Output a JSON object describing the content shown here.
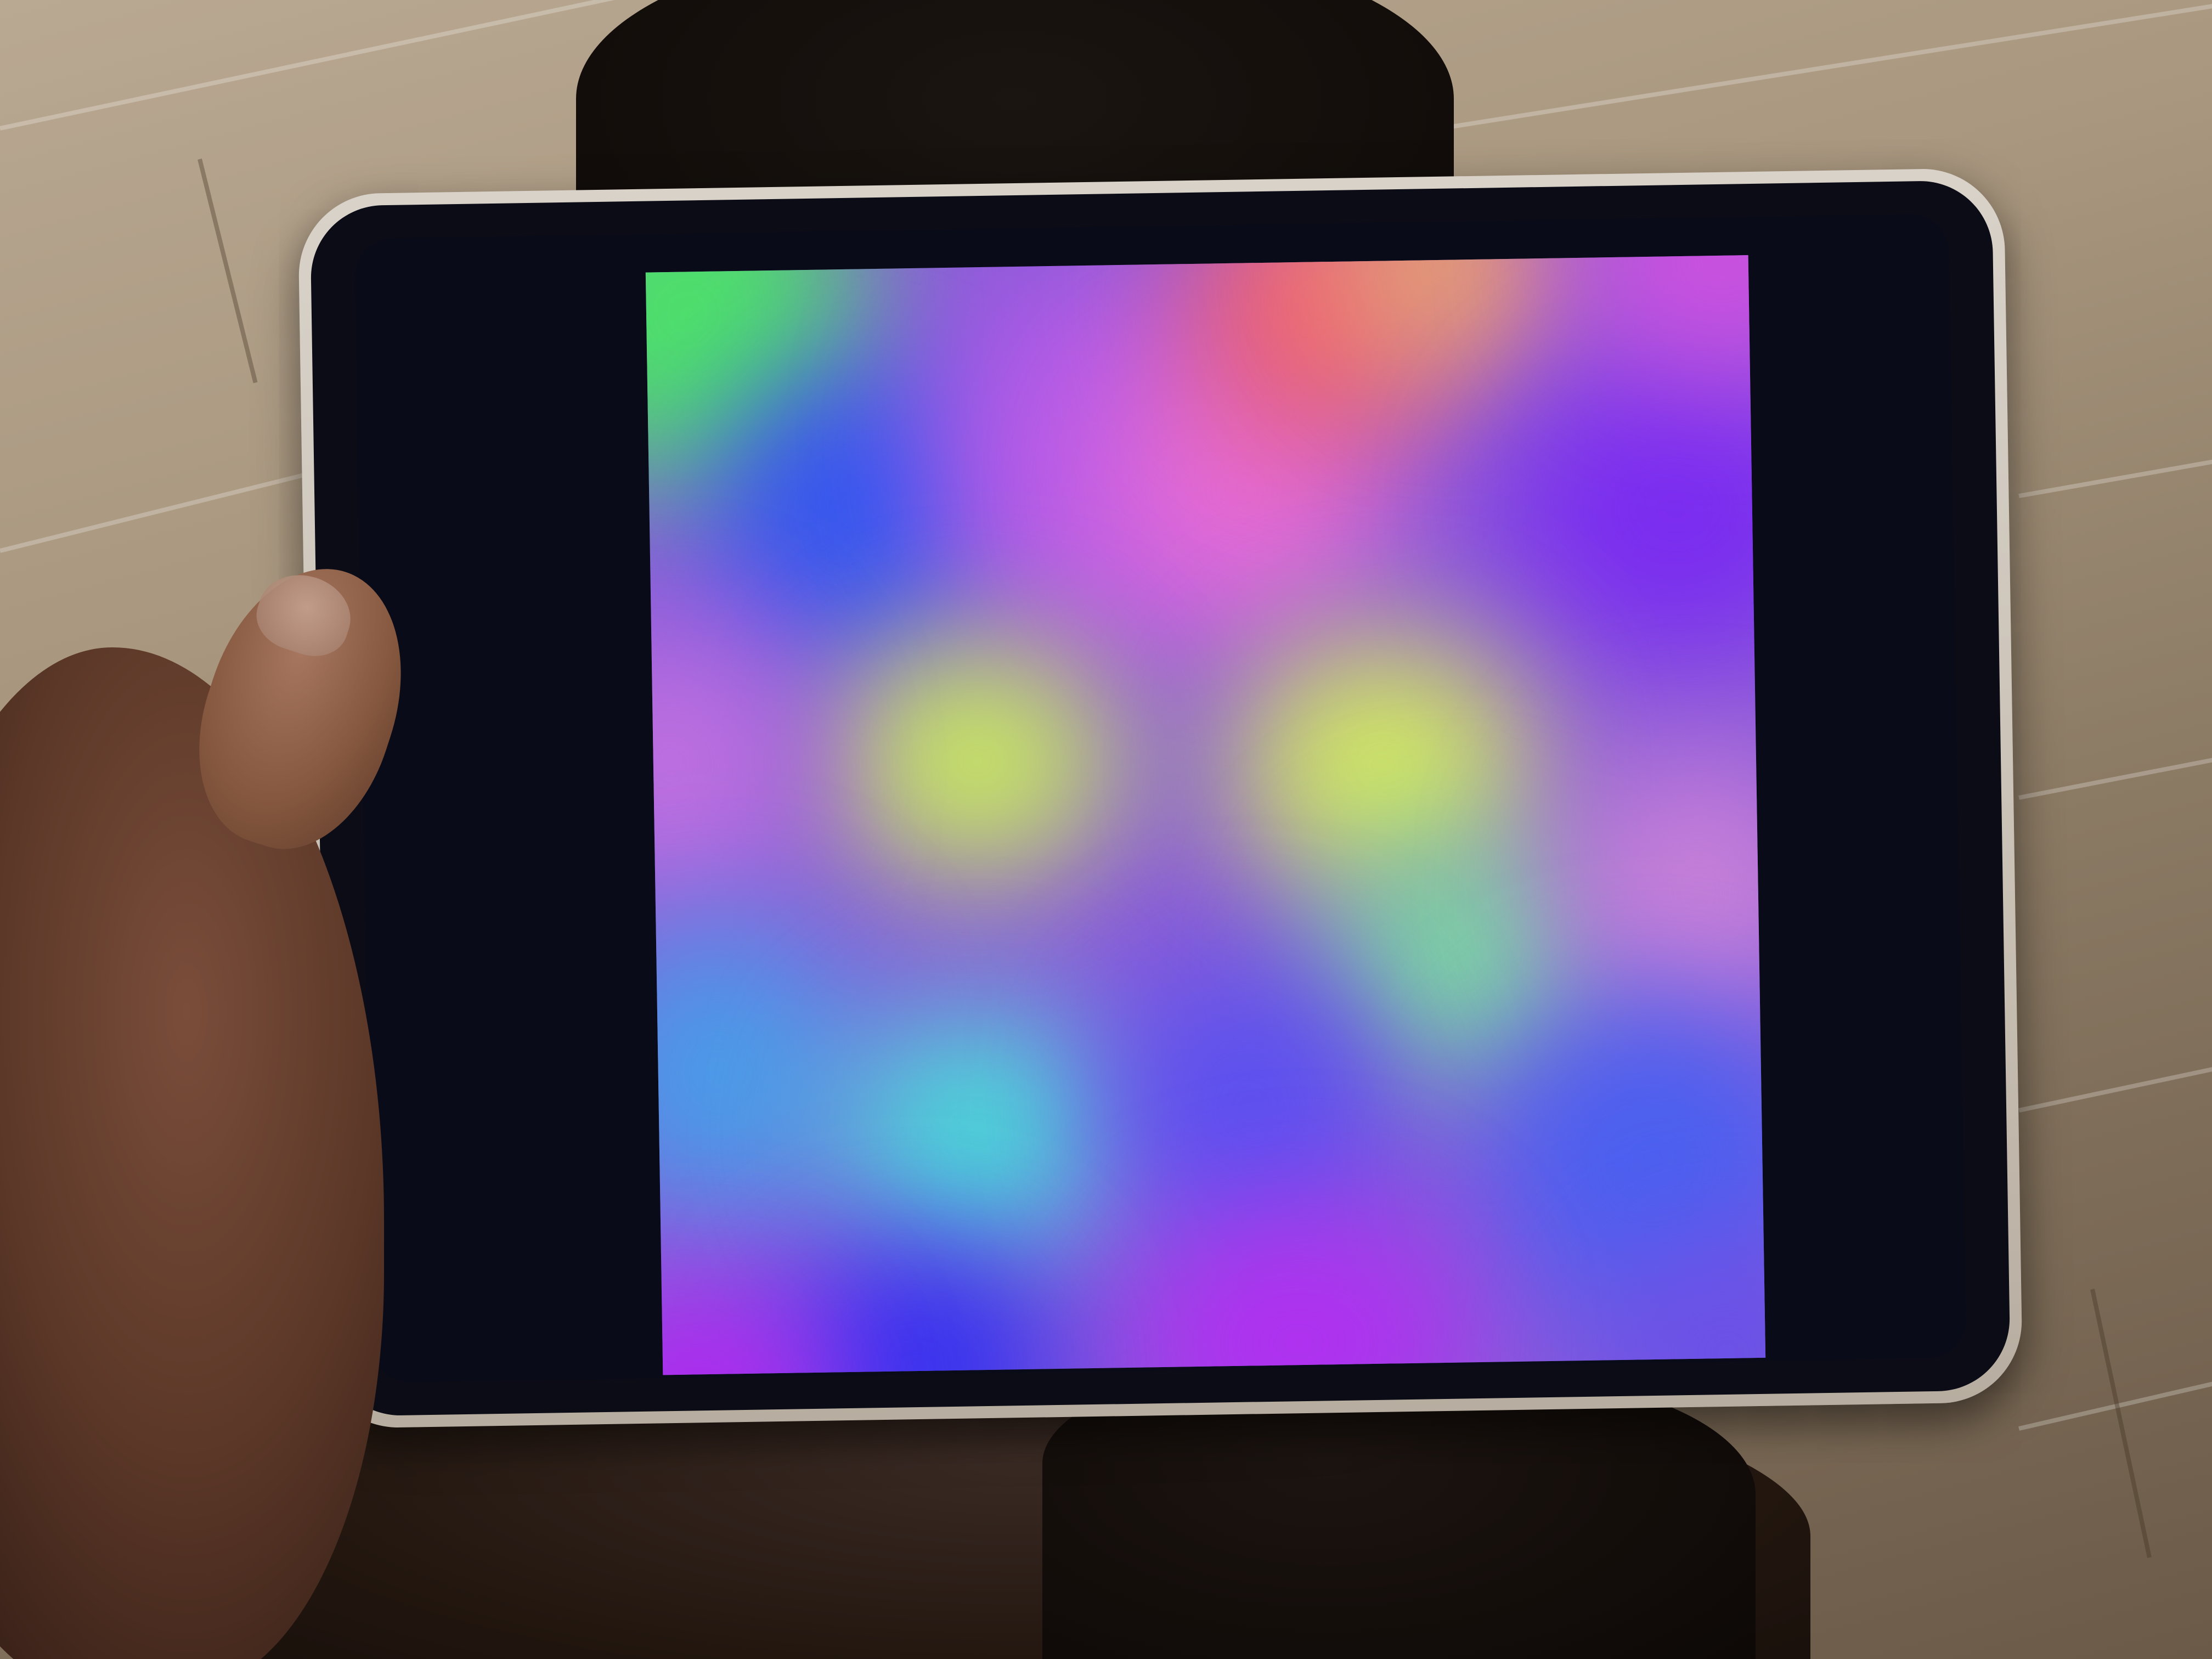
{
  "scene": {
    "subject": "tablet-displaying-color-gradient",
    "screen_colors": [
      "#4ee06a",
      "#2f56f0",
      "#d46ae0",
      "#f06070",
      "#7a2cf0",
      "#c8e860",
      "#4ad8d8",
      "#b030f0",
      "#4050f0"
    ],
    "device_frame_color": "#d4cdc3",
    "floor_color": "#a8967f"
  }
}
